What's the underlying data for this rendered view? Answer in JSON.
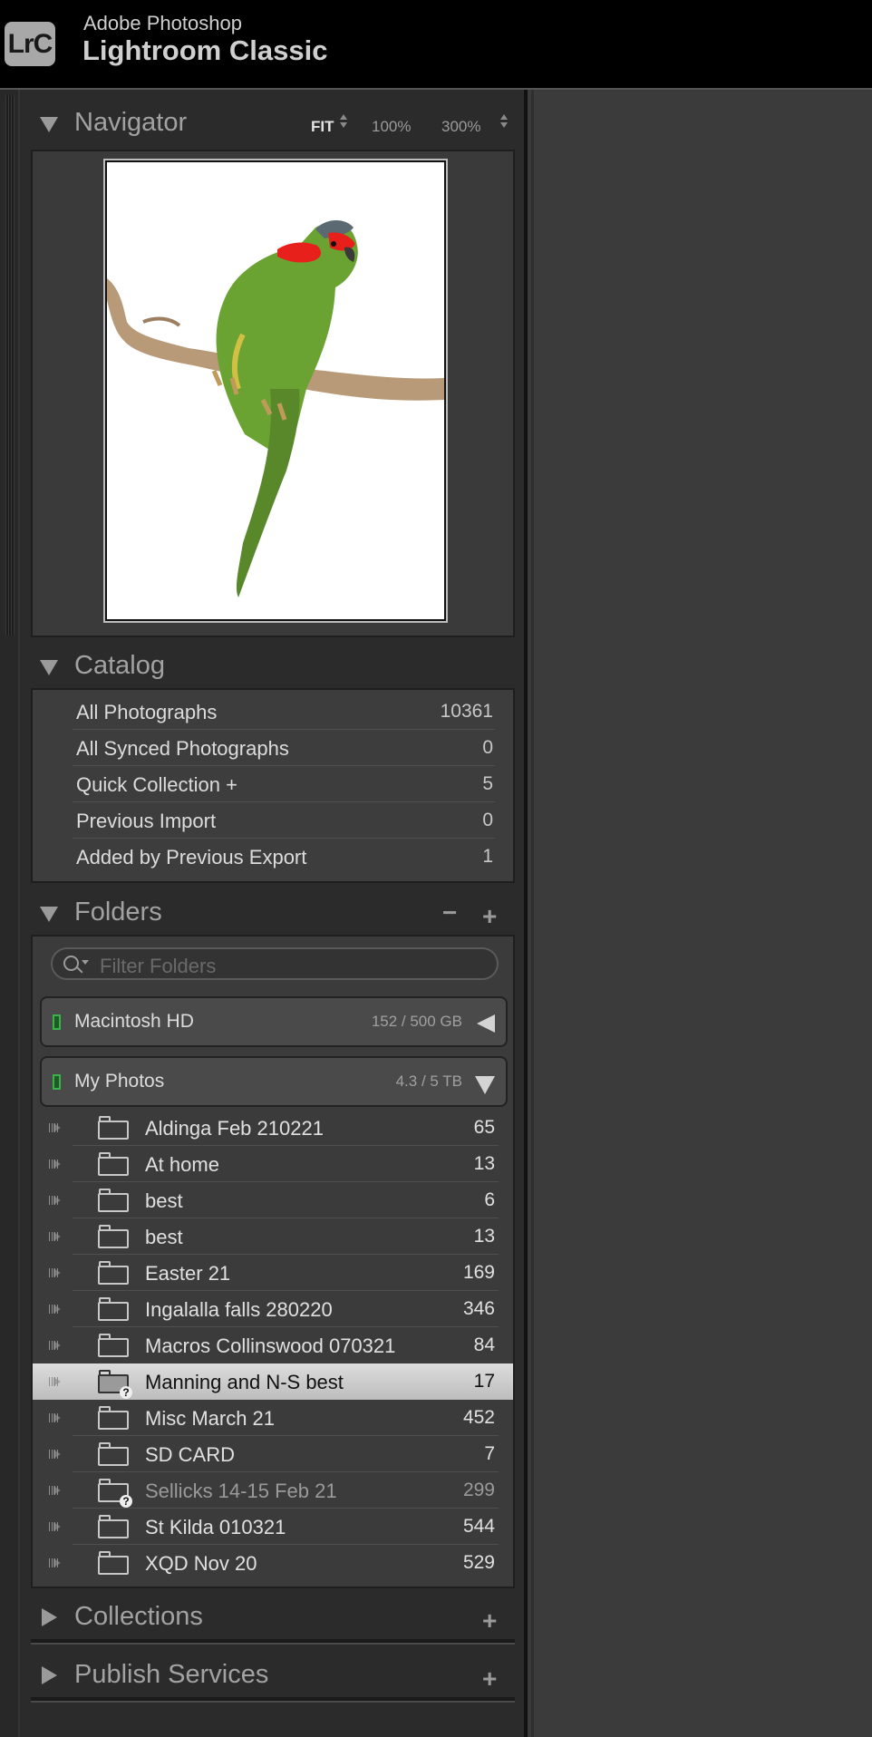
{
  "app": {
    "badge": "LrC",
    "vendor": "Adobe Photoshop",
    "product": "Lightroom Classic"
  },
  "navigator": {
    "title": "Navigator",
    "zoom": {
      "fit": "FIT",
      "z100": "100%",
      "z300": "300%"
    },
    "preview_icon": "bird-on-branch-photo"
  },
  "catalog": {
    "title": "Catalog",
    "items": [
      {
        "label": "All Photographs",
        "count": "10361"
      },
      {
        "label": "All Synced Photographs",
        "count": "0"
      },
      {
        "label": "Quick Collection  +",
        "count": "5"
      },
      {
        "label": "Previous Import",
        "count": "0"
      },
      {
        "label": "Added by Previous Export",
        "count": "1"
      }
    ]
  },
  "folders": {
    "title": "Folders",
    "minus": "−",
    "plus": "+",
    "filter_placeholder": "Filter Folders",
    "volumes": [
      {
        "name": "Macintosh HD",
        "size": "152 / 500 GB"
      },
      {
        "name": "My Photos",
        "size": "4.3 / 5 TB"
      }
    ],
    "items": [
      {
        "name": "Aldinga Feb 210221",
        "count": "65"
      },
      {
        "name": "At home",
        "count": "13"
      },
      {
        "name": "best",
        "count": "6"
      },
      {
        "name": "best",
        "count": "13"
      },
      {
        "name": "Easter 21",
        "count": "169"
      },
      {
        "name": "Ingalalla falls 280220",
        "count": "346"
      },
      {
        "name": "Macros Collinswood 070321",
        "count": "84"
      },
      {
        "name": "Manning and N-S best",
        "count": "17",
        "selected": true,
        "missing": true
      },
      {
        "name": "Misc March 21",
        "count": "452"
      },
      {
        "name": "SD CARD",
        "count": "7"
      },
      {
        "name": "Sellicks  14-15  Feb  21",
        "count": "299",
        "missing": true
      },
      {
        "name": "St Kilda 010321",
        "count": "544"
      },
      {
        "name": "XQD Nov 20",
        "count": "529"
      }
    ]
  },
  "collections": {
    "title": "Collections",
    "plus": "+"
  },
  "publish": {
    "title": "Publish Services",
    "plus": "+"
  },
  "colors": {
    "volume_led": "#37b34a",
    "selection": "#d0d0d0"
  }
}
